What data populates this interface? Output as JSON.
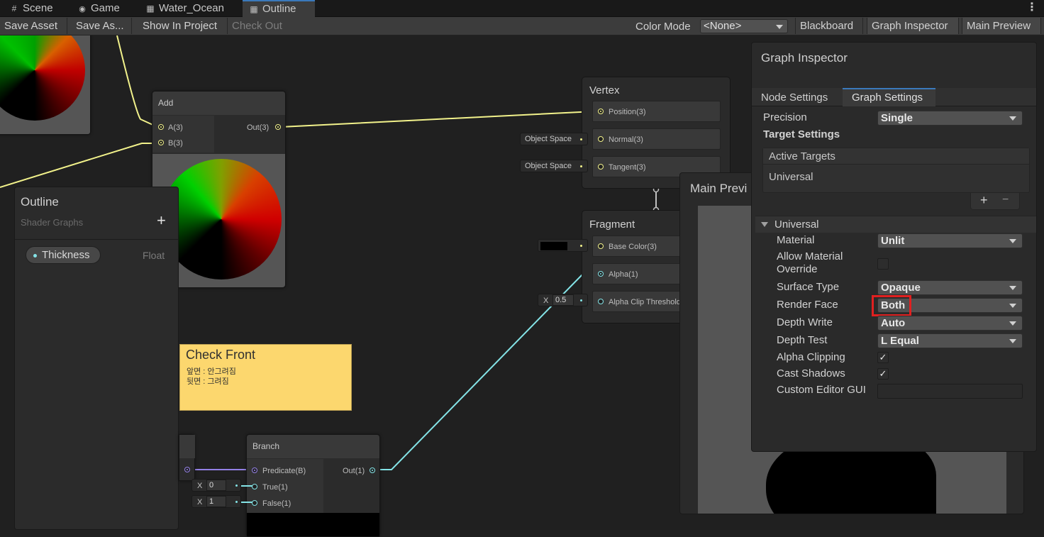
{
  "tabs": [
    {
      "label": "Scene",
      "icon": "grid-icon"
    },
    {
      "label": "Game",
      "icon": "gamepad-icon"
    },
    {
      "label": "Water_Ocean",
      "icon": "shader-graph-icon"
    },
    {
      "label": "Outline",
      "icon": "shader-graph-icon"
    }
  ],
  "toolbar": {
    "save_asset": "Save Asset",
    "save_as": "Save As...",
    "show_in_project": "Show In Project",
    "check_out": "Check Out",
    "color_mode_label": "Color Mode",
    "color_mode_value": "<None>",
    "blackboard": "Blackboard",
    "graph_inspector": "Graph Inspector",
    "main_preview": "Main Preview"
  },
  "add_node": {
    "title": "Add",
    "in_a": "A(3)",
    "in_b": "B(3)",
    "out": "Out(3)"
  },
  "vertex": {
    "title": "Vertex",
    "position": "Position(3)",
    "normal": "Normal(3)",
    "tangent": "Tangent(3)",
    "normal_space": "Object Space",
    "tangent_space": "Object Space"
  },
  "fragment": {
    "title": "Fragment",
    "base_color": "Base Color(3)",
    "alpha": "Alpha(1)",
    "alpha_clip": "Alpha Clip Threshold",
    "alpha_clip_x": "X",
    "alpha_clip_value": "0.5"
  },
  "blackboard": {
    "title": "Outline",
    "subtitle": "Shader Graphs",
    "add": "+",
    "property_name": "Thickness",
    "property_type": "Float"
  },
  "sticky_note": {
    "title": "Check Front",
    "line1": "앞면 : 안그려짐",
    "line2": "뒷면 : 그려짐"
  },
  "branch_node": {
    "title": "Branch",
    "predicate": "Predicate(B)",
    "true_label": "True(1)",
    "false_label": "False(1)",
    "out": "Out(1)",
    "true_x": "X",
    "true_value": "0",
    "false_x": "X",
    "false_value": "1"
  },
  "main_preview": {
    "title": "Main Previ"
  },
  "inspector": {
    "title": "Graph Inspector",
    "tab_node": "Node Settings",
    "tab_graph": "Graph Settings",
    "precision_label": "Precision",
    "precision_value": "Single",
    "target_settings": "Target Settings",
    "active_targets": "Active Targets",
    "target_universal": "Universal",
    "add": "+",
    "remove": "−",
    "section": "Universal",
    "material_label": "Material",
    "material_value": "Unlit",
    "allow_override_label1": "Allow Material",
    "allow_override_label2": "Override",
    "allow_override_checked": false,
    "surface_type_label": "Surface Type",
    "surface_type_value": "Opaque",
    "render_face_label": "Render Face",
    "render_face_value": "Both",
    "depth_write_label": "Depth Write",
    "depth_write_value": "Auto",
    "depth_test_label": "Depth Test",
    "depth_test_value": "L Equal",
    "alpha_clipping_label": "Alpha Clipping",
    "alpha_clipping_checked": true,
    "cast_shadows_label": "Cast Shadows",
    "cast_shadows_checked": true,
    "custom_editor_label": "Custom Editor GUI",
    "custom_editor_value": ""
  },
  "colors": {
    "accent": "#3a79bb",
    "highlight": "#e02020",
    "wire_vector3": "#f2f28b",
    "wire_float": "#84e4e7",
    "wire_bool": "#9481e6",
    "sticky": "#fcd76e"
  }
}
